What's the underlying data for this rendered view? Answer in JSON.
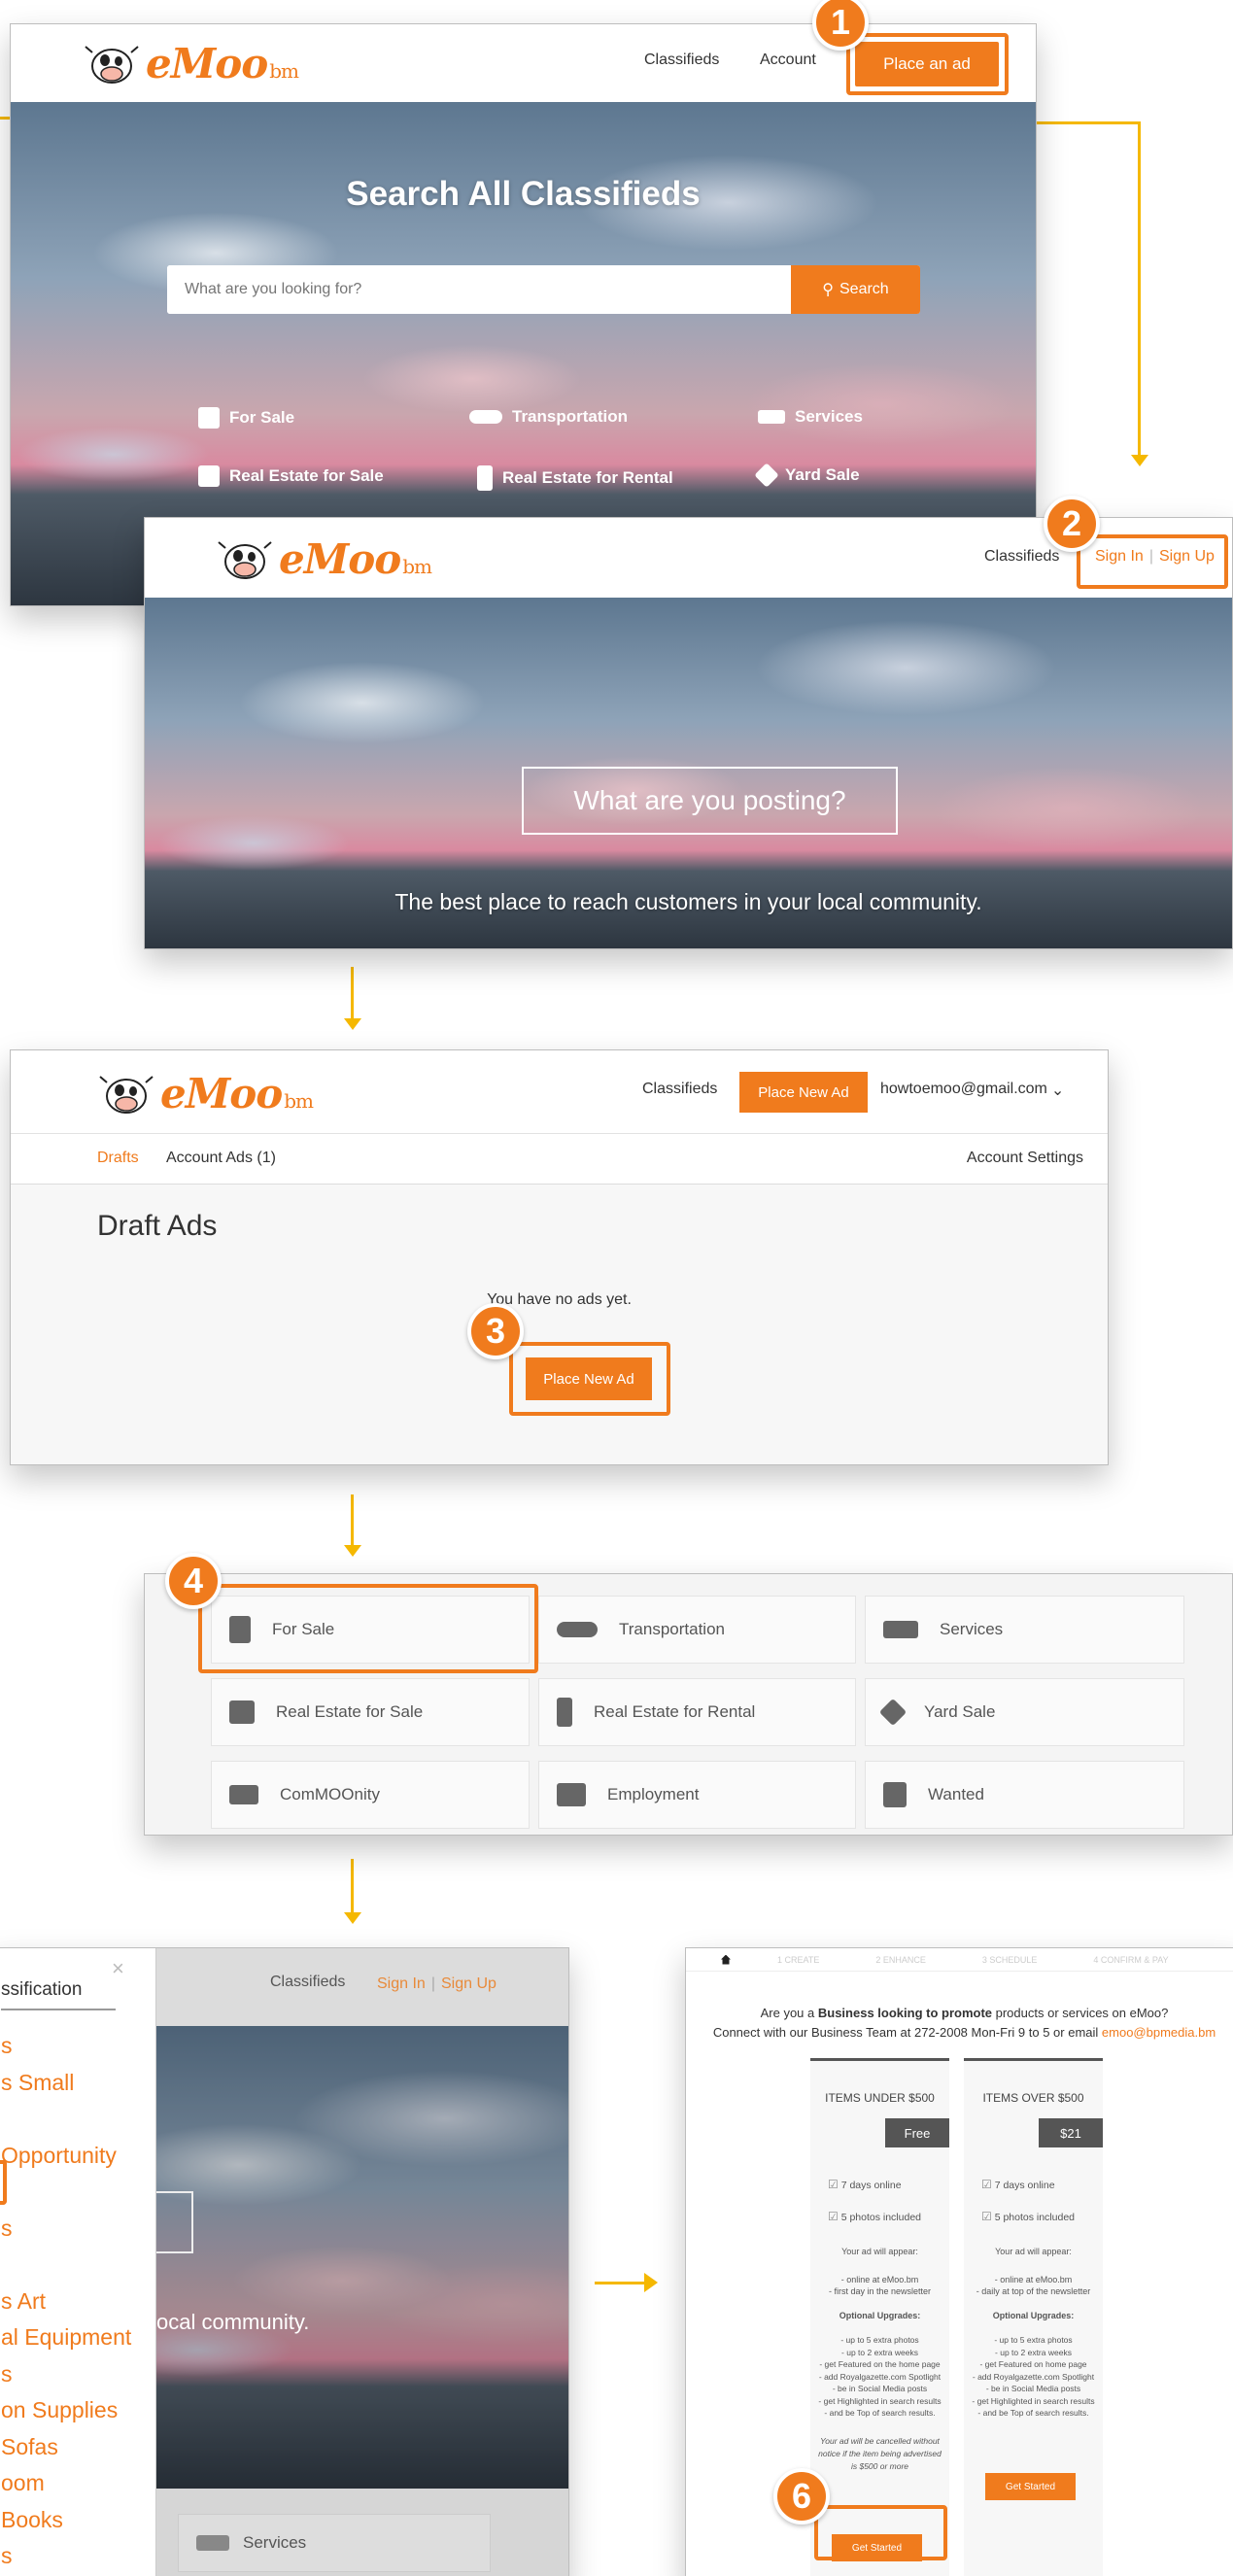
{
  "brand": {
    "logo_text": "eMoo",
    "logo_suffix": "bm"
  },
  "steps": [
    "1",
    "2",
    "3",
    "4",
    "6"
  ],
  "colors": {
    "accent": "#f07b1d",
    "arrow": "#f5b800"
  },
  "screen1": {
    "nav": {
      "classifieds": "Classifieds",
      "account": "Account",
      "place_ad": "Place an ad"
    },
    "hero_title": "Search All Classifieds",
    "search_placeholder": "What are you looking for?",
    "search_button": "Search",
    "categories": [
      {
        "label": "For Sale",
        "icon": "shopping-bag-icon"
      },
      {
        "label": "Transportation",
        "icon": "car-icon"
      },
      {
        "label": "Services",
        "icon": "handshake-icon"
      },
      {
        "label": "Real Estate for Sale",
        "icon": "sign-icon"
      },
      {
        "label": "Real Estate for Rental",
        "icon": "building-icon"
      },
      {
        "label": "Yard Sale",
        "icon": "tag-icon"
      }
    ]
  },
  "screen2": {
    "nav": {
      "classifieds": "Classifieds",
      "sign_in": "Sign In",
      "sep": "|",
      "sign_up": "Sign Up"
    },
    "hero_button": "What are you posting?",
    "tagline": "The best place to reach customers in your local community."
  },
  "screen3": {
    "nav": {
      "classifieds": "Classifieds",
      "place_new_ad": "Place New Ad",
      "email": "howtoemoo@gmail.com"
    },
    "tabs": {
      "drafts": "Drafts",
      "account_ads": "Account Ads (1)",
      "account_settings": "Account Settings"
    },
    "heading": "Draft Ads",
    "empty_text": "You have no ads yet.",
    "place_new_ad_button": "Place New Ad"
  },
  "screen4": {
    "categories": [
      {
        "label": "For Sale",
        "icon": "shopping-bag-icon"
      },
      {
        "label": "Transportation",
        "icon": "car-icon"
      },
      {
        "label": "Services",
        "icon": "handshake-icon"
      },
      {
        "label": "Real Estate for Sale",
        "icon": "sign-icon"
      },
      {
        "label": "Real Estate for Rental",
        "icon": "building-icon"
      },
      {
        "label": "Yard Sale",
        "icon": "tag-icon"
      },
      {
        "label": "ComMOOnity",
        "icon": "megaphone-icon"
      },
      {
        "label": "Employment",
        "icon": "briefcase-icon"
      },
      {
        "label": "Wanted",
        "icon": "house-icon"
      }
    ]
  },
  "screen5": {
    "sidebar_title": "ssification",
    "sidebar_items": [
      "s",
      "s Small",
      "",
      "Opportunity",
      "",
      "s",
      "",
      "s Art",
      "al Equipment",
      "s",
      "on Supplies",
      " Sofas",
      "oom",
      "Books",
      "s"
    ],
    "nav": {
      "classifieds": "Classifieds",
      "sign_in": "Sign In",
      "sep": "|",
      "sign_up": "Sign Up"
    },
    "hero_fragment": "ocal community.",
    "services_label": "Services"
  },
  "screen6": {
    "steps": [
      "1 CREATE",
      "2 ENHANCE",
      "3 SCHEDULE",
      "4 CONFIRM & PAY"
    ],
    "intro_line1_pre": "Are you a ",
    "intro_line1_bold": "Business looking to promote",
    "intro_line1_post": " products or services on eMoo?",
    "intro_line2": "Connect with our Business Team at 272-2008 Mon-Fri 9 to 5 or email ",
    "intro_email": "emoo@bpmedia.bm",
    "plans": [
      {
        "title": "ITEMS UNDER $500",
        "price": "Free",
        "features": [
          "7 days online",
          "5 photos included"
        ],
        "appear_title": "Your ad will appear:",
        "appear": [
          "- online at eMoo.bm",
          "- first day in the newsletter"
        ],
        "upgrades_title": "Optional Upgrades:",
        "upgrades": [
          "- up to 5 extra photos",
          "- up to 2 extra weeks",
          "- get Featured on the home page",
          "- add Royalgazette.com Spotlight",
          "- be in Social Media posts",
          "- get Highlighted in search results",
          "- and be Top of search results."
        ],
        "note": "Your ad will be cancelled without notice if the item being advertised is $500 or more",
        "button": "Get Started"
      },
      {
        "title": "ITEMS OVER $500",
        "price": "$21",
        "features": [
          "7 days online",
          "5 photos included"
        ],
        "appear_title": "Your ad will appear:",
        "appear": [
          "- online at eMoo.bm",
          "- daily at top of the newsletter"
        ],
        "upgrades_title": "Optional Upgrades:",
        "upgrades": [
          "- up to 5 extra photos",
          "- up to 2 extra weeks",
          "- get Featured on home page",
          "- add Royalgazette.com Spotlight",
          "- be in Social Media posts",
          "- get Highlighted in search results",
          "- and be Top of search results."
        ],
        "note": "",
        "button": "Get Started"
      }
    ]
  }
}
